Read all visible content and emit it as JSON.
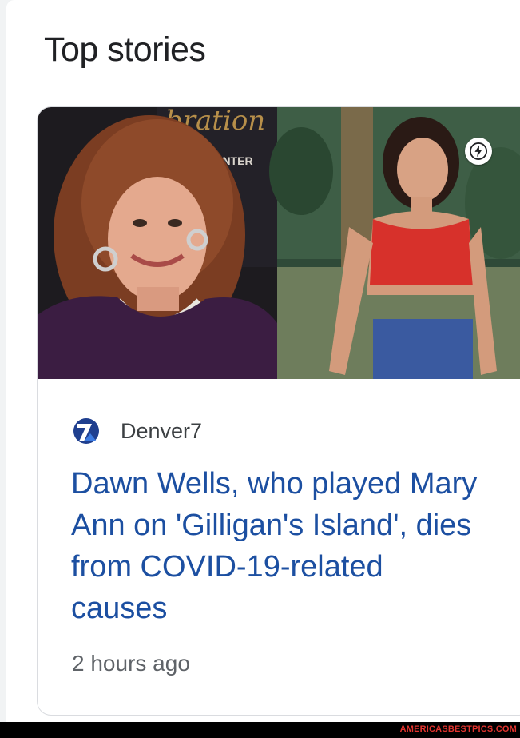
{
  "section": {
    "title": "Top stories"
  },
  "story": {
    "image_alt": "Photo of Dawn Wells then and now",
    "image_sign_text": "CENTER",
    "image_sign_script": "bration",
    "amp_icon": "lightning-bolt-icon",
    "source": {
      "name": "Denver7",
      "logo_icon": "denver7-logo-icon"
    },
    "headline": "Dawn Wells, who played Mary Ann on 'Gilligan's Island', dies from COVID-19-related causes",
    "time": "2 hours ago"
  },
  "watermark": "AMERICASBESTPICS.COM",
  "colors": {
    "headline": "#1c4fa1",
    "title": "#202124",
    "meta": "#5f6368",
    "watermark": "#e3342f"
  }
}
